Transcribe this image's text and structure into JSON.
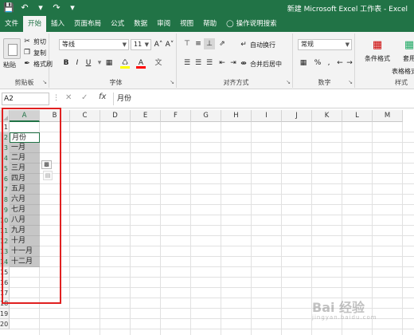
{
  "window": {
    "title": "新建 Microsoft Excel 工作表 - Excel"
  },
  "qat": {
    "save_icon": "save-icon",
    "undo_icon": "undo-icon",
    "redo_icon": "redo-icon",
    "customize_icon": "customize-icon"
  },
  "tabs": [
    {
      "label": "文件"
    },
    {
      "label": "开始"
    },
    {
      "label": "插入"
    },
    {
      "label": "页面布局"
    },
    {
      "label": "公式"
    },
    {
      "label": "数据"
    },
    {
      "label": "审阅"
    },
    {
      "label": "视图"
    },
    {
      "label": "帮助"
    },
    {
      "label": "操作说明搜索"
    }
  ],
  "ribbon": {
    "clipboard": {
      "label": "剪贴板",
      "paste": "粘贴",
      "cut": "剪切",
      "copy": "复制",
      "format_painter": "格式刷"
    },
    "font": {
      "label": "字体",
      "name": "等线",
      "size": "11",
      "grow": "A˄",
      "shrink": "A˅",
      "bold": "B",
      "italic": "I",
      "underline": "U",
      "font_color_letter": "A",
      "wen": "文"
    },
    "alignment": {
      "label": "对齐方式",
      "wrap": "自动换行",
      "merge": "合并后居中"
    },
    "number": {
      "label": "数字",
      "format": "常规",
      "percent": "%",
      "comma": ","
    },
    "styles": {
      "conditional": "条件格式",
      "table_line1": "套用",
      "table_line2": "表格格式",
      "label": "样式"
    }
  },
  "formula_bar": {
    "name_box": "A2",
    "fx": "fx",
    "content": "月份"
  },
  "columns": [
    "A",
    "B",
    "C",
    "D",
    "E",
    "F",
    "G",
    "H",
    "I",
    "J",
    "K",
    "L",
    "M"
  ],
  "rows": [
    "1",
    "2",
    "3",
    "4",
    "5",
    "6",
    "7",
    "8",
    "9",
    "10",
    "11",
    "12",
    "13",
    "14",
    "15",
    "16",
    "17",
    "18",
    "19",
    "20"
  ],
  "column_a": [
    "",
    "月份",
    "一月",
    "二月",
    "三月",
    "四月",
    "五月",
    "六月",
    "七月",
    "八月",
    "九月",
    "十月",
    "十一月",
    "十二月",
    "",
    "",
    "",
    "",
    "",
    ""
  ],
  "colors": {
    "accent": "#217346",
    "highlight": "#e02020"
  },
  "watermark": {
    "text": "Bai 经验",
    "sub": "jingyan.baidu.com"
  }
}
